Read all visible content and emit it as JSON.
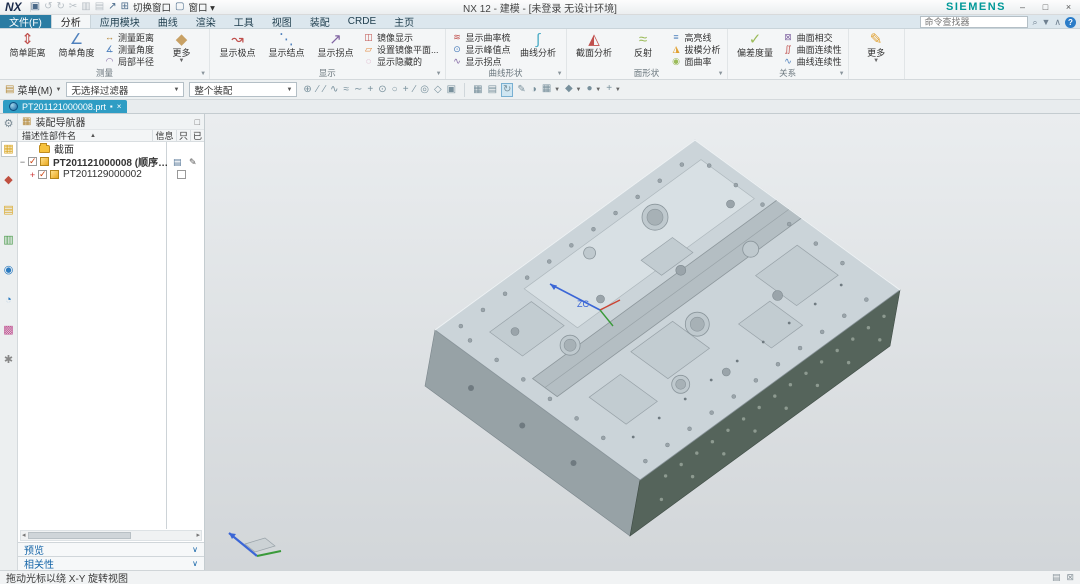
{
  "titlebar": {
    "logo": "NX",
    "title": "NX 12 - 建模 - [未登录 无设计环境]",
    "brand": "SIEMENS",
    "window_buttons": {
      "minimize": "–",
      "restore": "□",
      "close": "×"
    },
    "quick_access": [
      {
        "name": "save-icon",
        "glyph": "▣",
        "enabled": true
      },
      {
        "name": "undo-icon",
        "glyph": "↺",
        "enabled": false
      },
      {
        "name": "redo-icon",
        "glyph": "↻",
        "enabled": false
      },
      {
        "name": "cut-icon",
        "glyph": "✂",
        "enabled": false
      },
      {
        "name": "copy-icon",
        "glyph": "▥",
        "enabled": false
      },
      {
        "name": "paste-icon",
        "glyph": "▤",
        "enabled": false
      },
      {
        "name": "share-icon",
        "glyph": "↗",
        "enabled": true
      },
      {
        "name": "switch-window-button",
        "glyph": "⊞",
        "label": "切换窗口",
        "enabled": true
      },
      {
        "name": "window-menu-button",
        "glyph": "▢",
        "label": "窗口",
        "enabled": true,
        "dropdown": true
      }
    ]
  },
  "ribbon_tabs": [
    {
      "label": "文件(F)",
      "style": "file"
    },
    {
      "label": "分析",
      "active": true
    },
    {
      "label": "应用模块"
    },
    {
      "label": "曲线"
    },
    {
      "label": "渲染"
    },
    {
      "label": "工具"
    },
    {
      "label": "视图"
    },
    {
      "label": "装配"
    },
    {
      "label": "CRDE"
    },
    {
      "label": "主页"
    }
  ],
  "command_finder": {
    "placeholder": "命令查找器"
  },
  "ribbon_groups": [
    {
      "label": "测量",
      "launcher": true,
      "cells": [
        {
          "type": "big",
          "items": [
            {
              "name": "simple-distance-button",
              "label": "简单距离",
              "glyph": "⇕",
              "color": "#c0504d"
            },
            {
              "name": "simple-angle-button",
              "label": "简单角度",
              "glyph": "∠",
              "color": "#4f81bd"
            }
          ]
        },
        {
          "type": "stack",
          "items": [
            {
              "name": "measure-distance-button",
              "label": "测量距离",
              "glyph": "↔",
              "color": "#b08030"
            },
            {
              "name": "measure-angle-button",
              "label": "测量角度",
              "glyph": "∡",
              "color": "#4f81bd"
            },
            {
              "name": "local-radius-button",
              "label": "局部半径",
              "glyph": "◠",
              "color": "#8064a2"
            }
          ]
        },
        {
          "type": "big",
          "items": [
            {
              "name": "measure-more-button",
              "label": "更多",
              "glyph": "◆",
              "color": "#c8a165",
              "dropdown": true
            }
          ]
        }
      ]
    },
    {
      "label": "显示",
      "launcher": true,
      "cells": [
        {
          "type": "big",
          "items": [
            {
              "name": "show-poles-button",
              "label": "显示极点",
              "glyph": "↝",
              "color": "#c0504d"
            },
            {
              "name": "show-knots-button",
              "label": "显示结点",
              "glyph": "⋱",
              "color": "#4f81bd"
            },
            {
              "name": "show-inflection-button",
              "label": "显示拐点",
              "glyph": "↗",
              "color": "#8064a2"
            }
          ]
        },
        {
          "type": "stack",
          "items": [
            {
              "name": "mirror-display-button",
              "label": "镜像显示",
              "glyph": "◫",
              "color": "#c0504d"
            },
            {
              "name": "set-mirror-plane-button",
              "label": "设置镜像平面...",
              "glyph": "▱",
              "color": "#e08030"
            },
            {
              "name": "show-hidden-button",
              "label": "显示隐藏的",
              "glyph": "◌",
              "color": "#c06090"
            }
          ]
        }
      ]
    },
    {
      "label": "曲线形状",
      "launcher": true,
      "cells": [
        {
          "type": "stack",
          "items": [
            {
              "name": "show-curvature-comb-button",
              "label": "显示曲率梳",
              "glyph": "≋",
              "color": "#c0504d"
            },
            {
              "name": "show-peak-points-button",
              "label": "显示峰值点",
              "glyph": "⊙",
              "color": "#4f81bd"
            },
            {
              "name": "show-inflections-button",
              "label": "显示拐点",
              "glyph": "∿",
              "color": "#8064a2"
            }
          ]
        },
        {
          "type": "big",
          "items": [
            {
              "name": "curve-analysis-button",
              "label": "曲线分析",
              "glyph": "∫",
              "color": "#4bacc6"
            }
          ]
        }
      ]
    },
    {
      "label": "面形状",
      "launcher": true,
      "cells": [
        {
          "type": "big",
          "items": [
            {
              "name": "section-analysis-button",
              "label": "截面分析",
              "glyph": "◭",
              "color": "#c0504d"
            },
            {
              "name": "reflection-button",
              "label": "反射",
              "glyph": "≈",
              "color": "#9bbb59"
            }
          ]
        },
        {
          "type": "stack",
          "items": [
            {
              "name": "highlight-lines-button",
              "label": "高亮线",
              "glyph": "≡",
              "color": "#4f81bd"
            },
            {
              "name": "draft-analysis-button",
              "label": "拔模分析",
              "glyph": "◮",
              "color": "#e0a030"
            },
            {
              "name": "face-curvature-button",
              "label": "面曲率",
              "glyph": "◉",
              "color": "#9bbb59"
            }
          ]
        }
      ]
    },
    {
      "label": "关系",
      "launcher": true,
      "cells": [
        {
          "type": "big",
          "items": [
            {
              "name": "deviation-gauge-button",
              "label": "偏差度量",
              "glyph": "✓",
              "color": "#9bbb59"
            }
          ]
        },
        {
          "type": "stack",
          "items": [
            {
              "name": "surface-intersection-button",
              "label": "曲面相交",
              "glyph": "⊠",
              "color": "#8064a2"
            },
            {
              "name": "surface-continuity-button",
              "label": "曲面连续性",
              "glyph": "∬",
              "color": "#c0504d"
            },
            {
              "name": "curve-continuity-button",
              "label": "曲线连续性",
              "glyph": "∿",
              "color": "#4f81bd"
            }
          ]
        }
      ]
    },
    {
      "label": "",
      "launcher": false,
      "cells": [
        {
          "type": "big",
          "items": [
            {
              "name": "ribbon-more-button",
              "label": "更多",
              "glyph": "✎",
              "color": "#e0a030",
              "dropdown": true
            }
          ]
        }
      ]
    }
  ],
  "border_bar": {
    "menu_label": "菜单(M)",
    "selection_filter": "无选择过滤器",
    "scope": "整个装配",
    "snap_icons": [
      {
        "name": "snap-enable-icon",
        "glyph": "⊕"
      },
      {
        "name": "snap-endpoint-icon",
        "glyph": "∕"
      },
      {
        "name": "snap-midpoint-icon",
        "glyph": "∕"
      },
      {
        "name": "snap-pole-icon",
        "glyph": "∿"
      },
      {
        "name": "snap-spline-icon",
        "glyph": "≈"
      },
      {
        "name": "snap-curve-icon",
        "glyph": "∼"
      },
      {
        "name": "snap-intersection-icon",
        "glyph": "+"
      },
      {
        "name": "snap-arc-center-icon",
        "glyph": "⊙"
      },
      {
        "name": "snap-circle-icon",
        "glyph": "○"
      },
      {
        "name": "snap-point-icon",
        "glyph": "+"
      },
      {
        "name": "snap-tangent-icon",
        "glyph": "∕"
      },
      {
        "name": "snap-quadrant-icon",
        "glyph": "◎"
      },
      {
        "name": "snap-face-icon",
        "glyph": "◇"
      },
      {
        "name": "snap-grid-icon",
        "glyph": "▣"
      }
    ],
    "view_icons": [
      {
        "name": "view-fit-icon",
        "glyph": "▦"
      },
      {
        "name": "view-window-icon",
        "glyph": "▤"
      },
      {
        "name": "view-rotate-icon",
        "glyph": "↻",
        "active": true
      },
      {
        "name": "view-pan-icon",
        "glyph": "✎"
      },
      {
        "name": "view-shaded-icon",
        "glyph": "◑"
      },
      {
        "name": "view-orient-icon",
        "glyph": "▦",
        "dropdown": true
      },
      {
        "name": "view-style-icon",
        "glyph": "◆",
        "dropdown": true
      },
      {
        "name": "view-render-icon",
        "glyph": "●",
        "dropdown": true
      },
      {
        "name": "view-effects-icon",
        "glyph": "+",
        "dropdown": true
      }
    ]
  },
  "part_tab_bar": {
    "tabs": [
      {
        "label": "PT201121000008.prt",
        "pin": "▪",
        "close": "×",
        "active": true
      }
    ]
  },
  "resource_bar": [
    {
      "name": "roles-gear-icon",
      "glyph": "⚙",
      "color": "#7a8a94",
      "first": true
    },
    {
      "name": "assembly-navigator-icon",
      "glyph": "▦",
      "color": "#d9a520",
      "active": true
    },
    {
      "name": "constraint-navigator-icon",
      "glyph": "◆",
      "color": "#c05040"
    },
    {
      "name": "part-navigator-icon",
      "glyph": "▤",
      "color": "#d9a520"
    },
    {
      "name": "reuse-library-icon",
      "glyph": "▥",
      "color": "#4a9a4a"
    },
    {
      "name": "web-browser-icon",
      "glyph": "◉",
      "color": "#2a7ac0"
    },
    {
      "name": "history-icon",
      "glyph": "◔",
      "color": "#2a7ac0"
    },
    {
      "name": "visualization-icon",
      "glyph": "▩",
      "color": "#c05090"
    },
    {
      "name": "machining-icon",
      "glyph": "✱",
      "color": "#888888"
    }
  ],
  "assembly_navigator": {
    "title": "装配导航器",
    "float_glyph": "□",
    "columns": {
      "name": "描述性部件名",
      "sort": "▲",
      "info": "信息",
      "readonly": "只",
      "modified": "已"
    },
    "rows": [
      {
        "type": "folder",
        "label": "截面",
        "indent": 1
      },
      {
        "type": "part",
        "label": "PT201121000008 (顺序: 时...",
        "bold": true,
        "expander": "−",
        "checked": true,
        "save_icon": "▤",
        "edit_icon": "✎",
        "indent": 0
      },
      {
        "type": "part",
        "label": "PT201129000002",
        "expander": "+",
        "expander_red": true,
        "checked": true,
        "readonly_checkbox": true,
        "indent": 1
      }
    ],
    "sections": [
      {
        "name": "preview-section",
        "label": "预览",
        "chevron": "∨"
      },
      {
        "name": "dependencies-section",
        "label": "相关性",
        "chevron": "∨"
      }
    ]
  },
  "graphics": {
    "wcs_label": "ZC",
    "colors": {
      "top_face": "#cbd4d9",
      "top_face_light": "#d8e0e4",
      "pocket": "#c2ccd1",
      "channel": "#b4bec3",
      "edge": "#8a959b",
      "side_dark": "#55645b",
      "side_dark_edge": "#3f4c45",
      "side_light": "#97a2a6",
      "hole": "#9aa4aa",
      "hole_dark": "#6f7a80",
      "side_hole": "#8d9a90",
      "wcs_blue": "#3b66d6",
      "wcs_red": "#cc4433",
      "wcs_green": "#3a9a3a",
      "triad_plane": "#ccd2d5"
    }
  },
  "status_bar": {
    "message": "拖动光标以绕 X-Y 旋转视图",
    "right_icons": [
      {
        "name": "status-grid-icon",
        "glyph": "▤"
      },
      {
        "name": "status-clip-icon",
        "glyph": "⊠"
      }
    ]
  }
}
